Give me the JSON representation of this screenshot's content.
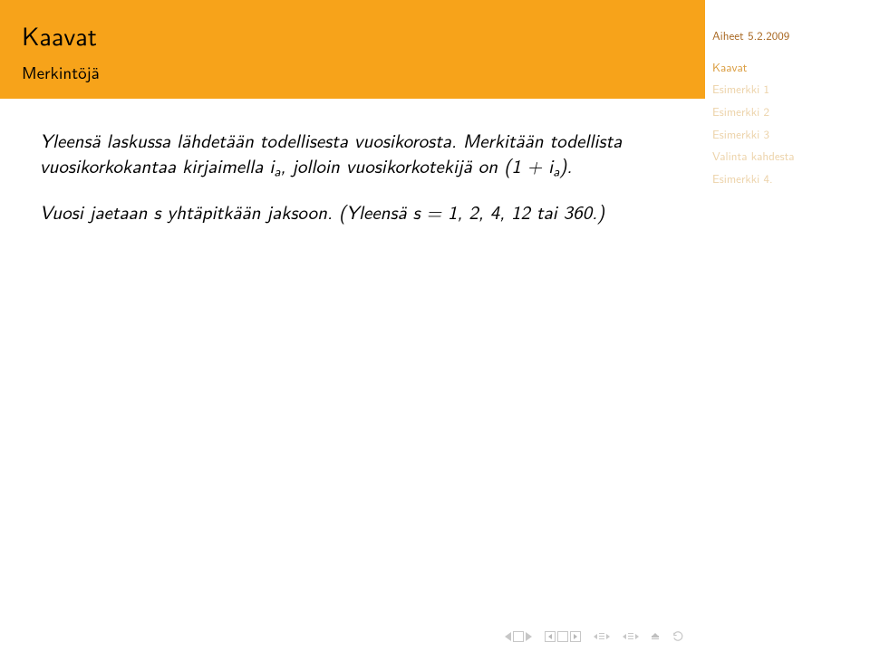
{
  "header": {
    "title": "Kaavat",
    "subtitle": "Merkintöjä"
  },
  "body": {
    "p1a": "Yleensä laskussa lähdetään todellisesta vuosikorosta. Merkitään todellista vuosikorkokantaa kirjaimella ",
    "p1_i": "i",
    "p1_a": "a",
    "p1b": ", jolloin vuosikorkotekijä on ",
    "p1_factor_open": "(1 + ",
    "p1_factor_i": "i",
    "p1_factor_a": "a",
    "p1_factor_close": ").",
    "p2a": "Vuosi jaetaan s yhtäpitkään jaksoon. (Yleensä s = 1, 2, 4, 12 tai 360.)"
  },
  "sidebar": {
    "doc_title": "Aiheet 5.2.2009",
    "items": [
      {
        "label": "Kaavat",
        "active": true
      },
      {
        "label": "Esimerkki 1",
        "active": false
      },
      {
        "label": "Esimerkki 2",
        "active": false
      },
      {
        "label": "Esimerkki 3",
        "active": false
      },
      {
        "label": "Valinta kahdesta",
        "active": false
      },
      {
        "label": "Esimerkki 4.",
        "active": false
      }
    ]
  }
}
